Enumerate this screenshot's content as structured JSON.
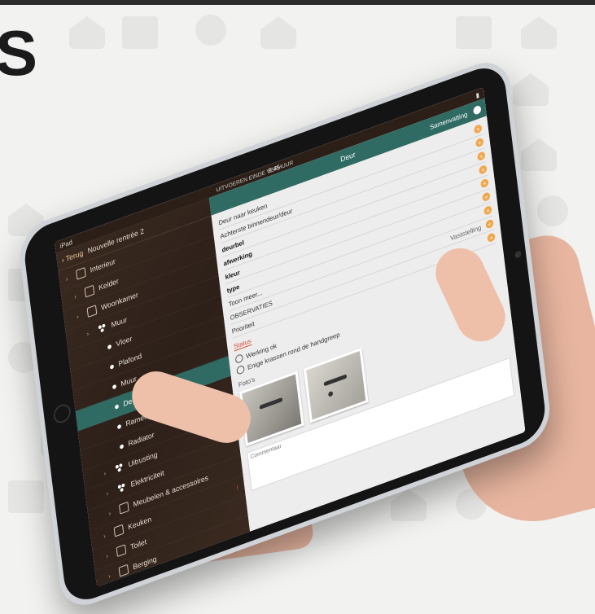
{
  "corner": {
    "text": "S"
  },
  "status": {
    "carrier": "iPad",
    "time": "9:45"
  },
  "left": {
    "back_label": "Terug",
    "nav_title": "Nouvelle rentrée 2",
    "tree": [
      {
        "label": "Interieur",
        "level": 0,
        "icon": "house-icon"
      },
      {
        "label": "Kelder",
        "level": 1,
        "icon": "folder-icon"
      },
      {
        "label": "Woonkamer",
        "level": 1,
        "icon": "box-icon"
      },
      {
        "label": "Muur",
        "level": 2,
        "icon": "cluster-icon"
      },
      {
        "label": "Vloer",
        "level": 3,
        "icon": "dot-icon"
      },
      {
        "label": "Plafond",
        "level": 3,
        "icon": "dot-icon"
      },
      {
        "label": "Muur",
        "level": 3,
        "icon": "dot-icon"
      },
      {
        "label": "Deur",
        "level": 3,
        "icon": "dot-icon",
        "active": true
      },
      {
        "label": "Ramen",
        "level": 3,
        "icon": "dot-icon"
      },
      {
        "label": "Radiator",
        "level": 3,
        "icon": "dot-icon"
      },
      {
        "label": "Uitrusting",
        "level": 2,
        "icon": "cluster-icon"
      },
      {
        "label": "Elektriciteit",
        "level": 2,
        "icon": "cluster-icon"
      },
      {
        "label": "Meubelen & accessoires",
        "level": 2,
        "icon": "gear-icon"
      },
      {
        "label": "Keuken",
        "level": 1,
        "icon": "box-icon",
        "flag": "!"
      },
      {
        "label": "Toilet",
        "level": 1,
        "icon": "box-icon"
      },
      {
        "label": "Berging",
        "level": 1,
        "icon": "box-icon"
      }
    ]
  },
  "right": {
    "top_title": "UITVOEREN EINDE VERHUUR",
    "header_title": "Deur",
    "summary_label": "Samenvatting",
    "rows": [
      {
        "label": "Deur naar keuken",
        "value": "",
        "bold": false
      },
      {
        "label": "Achterste binnendeur/deur",
        "value": "",
        "bold": false
      },
      {
        "label": "deurbel",
        "value": "",
        "bold": true
      },
      {
        "label": "afwerking",
        "value": "",
        "bold": true
      },
      {
        "label": "kleur",
        "value": "",
        "bold": true
      },
      {
        "label": "type",
        "value": "",
        "bold": true
      },
      {
        "label": "Toon meer...",
        "value": "",
        "bold": false
      },
      {
        "label": "OBSERVATIES",
        "value": "Vaststelling",
        "bold": false
      },
      {
        "label": "Prioriteit",
        "value": "",
        "bold": false
      }
    ],
    "tabs": [
      "Status"
    ],
    "notes": [
      "Werking ok",
      "Enige krassen rond de handgreep"
    ],
    "photos_label": "Foto's",
    "comment_label": "Commentaar"
  }
}
